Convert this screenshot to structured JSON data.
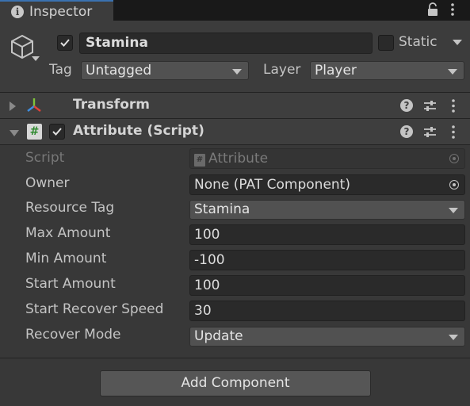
{
  "tab": {
    "title": "Inspector"
  },
  "gameobject": {
    "active": true,
    "name": "Stamina",
    "static_label": "Static",
    "static_checked": false,
    "tag_label": "Tag",
    "tag_value": "Untagged",
    "layer_label": "Layer",
    "layer_value": "Player"
  },
  "components": [
    {
      "title": "Transform",
      "expanded": false,
      "icon": "transform-icon"
    },
    {
      "title": "Attribute (Script)",
      "expanded": true,
      "enabled": true,
      "icon": "script-icon"
    }
  ],
  "attribute": {
    "properties": {
      "script": {
        "label": "Script",
        "value": "Attribute"
      },
      "owner": {
        "label": "Owner",
        "value": "None (PAT Component)"
      },
      "resource_tag": {
        "label": "Resource Tag",
        "value": "Stamina"
      },
      "max_amount": {
        "label": "Max Amount",
        "value": "100"
      },
      "min_amount": {
        "label": "Min Amount",
        "value": "-100"
      },
      "start_amount": {
        "label": "Start Amount",
        "value": "100"
      },
      "start_recover_speed": {
        "label": "Start Recover Speed",
        "value": "30"
      },
      "recover_mode": {
        "label": "Recover Mode",
        "value": "Update"
      }
    }
  },
  "footer": {
    "add_component_label": "Add Component"
  },
  "colors": {
    "panel": "#383838",
    "header": "#3c3c3c",
    "field": "#2a2a2a",
    "tab_accent": "#3a72b0",
    "button": "#565656"
  }
}
